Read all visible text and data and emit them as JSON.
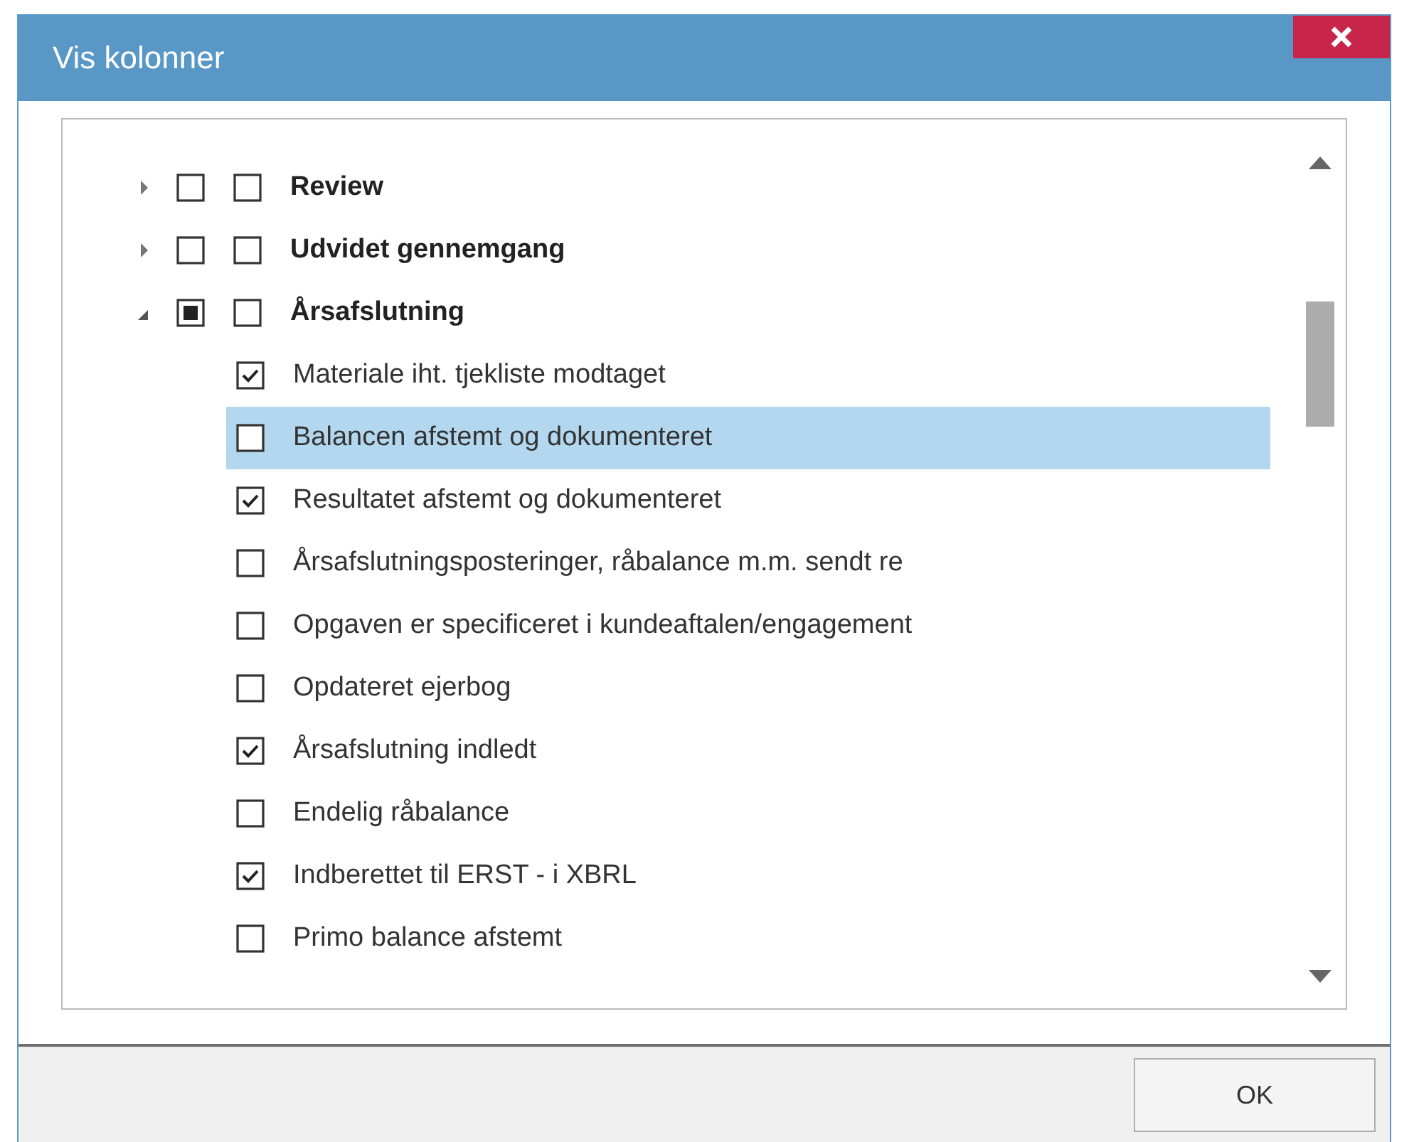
{
  "window": {
    "title": "Vis kolonner"
  },
  "tree": [
    {
      "label": "Review",
      "expanded": false,
      "partial": false,
      "checked": false,
      "checked_2": false
    },
    {
      "label": "Udvidet gennemgang",
      "expanded": false,
      "partial": false,
      "checked": false,
      "checked_2": false
    },
    {
      "label": "Årsafslutning",
      "expanded": true,
      "partial": true,
      "checked": false,
      "checked_2": false,
      "children": [
        {
          "label": "Materiale iht. tjekliste modtaget",
          "checked": true,
          "selected": false
        },
        {
          "label": "Balancen afstemt og dokumenteret",
          "checked": false,
          "selected": true
        },
        {
          "label": "Resultatet afstemt og dokumenteret",
          "checked": true,
          "selected": false
        },
        {
          "label": "Årsafslutningsposteringer, råbalance m.m. sendt re",
          "checked": false,
          "selected": false
        },
        {
          "label": "Opgaven er specificeret i kundeaftalen/engagement",
          "checked": false,
          "selected": false
        },
        {
          "label": "Opdateret ejerbog",
          "checked": false,
          "selected": false
        },
        {
          "label": "Årsafslutning indledt",
          "checked": true,
          "selected": false
        },
        {
          "label": "Endelig råbalance",
          "checked": false,
          "selected": false
        },
        {
          "label": "Indberettet til ERST - i XBRL",
          "checked": true,
          "selected": false
        },
        {
          "label": "Primo balance afstemt",
          "checked": false,
          "selected": false
        }
      ]
    }
  ],
  "buttons": [
    {
      "label": "OK"
    }
  ]
}
